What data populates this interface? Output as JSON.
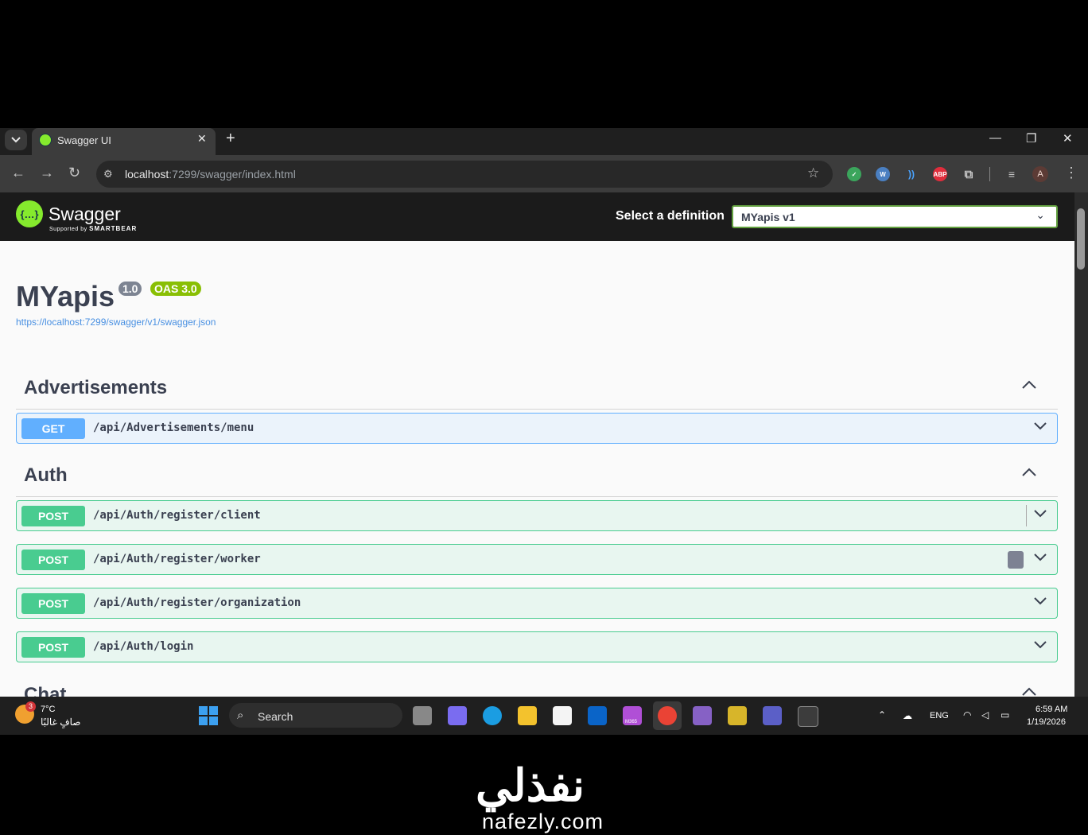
{
  "browser": {
    "tab_title": "Swagger UI",
    "url_host": "localhost",
    "url_rest": ":7299/swagger/index.html",
    "avatar_letter": "A",
    "ext_abp": "ABP"
  },
  "swagger": {
    "brand": "Swagger",
    "supported_by": "Supported by",
    "smartbear": "SMARTBEAR",
    "select_label": "Select a definition",
    "selected_definition": "MYapis v1",
    "title": "MYapis",
    "version_badge": "1.0",
    "oas_badge": "OAS 3.0",
    "spec_url": "https://localhost:7299/swagger/v1/swagger.json",
    "colors": {
      "get": "#61affe",
      "post": "#49cc90",
      "badge_version": "#7d8492",
      "badge_oas": "#89bf04",
      "brand": "#85ea2d"
    }
  },
  "tags": [
    {
      "name": "Advertisements",
      "operations": [
        {
          "method": "GET",
          "path": "/api/Advertisements/menu"
        }
      ]
    },
    {
      "name": "Auth",
      "operations": [
        {
          "method": "POST",
          "path": "/api/Auth/register/client"
        },
        {
          "method": "POST",
          "path": "/api/Auth/register/worker"
        },
        {
          "method": "POST",
          "path": "/api/Auth/register/organization"
        },
        {
          "method": "POST",
          "path": "/api/Auth/login"
        }
      ]
    },
    {
      "name": "Chat",
      "operations": []
    }
  ],
  "taskbar": {
    "weather_badge": "3",
    "temperature": "7°C",
    "condition": "صافٍ غالبًا",
    "search_placeholder": "Search",
    "language": "ENG",
    "time": "6:59 AM",
    "date": "1/19/2026",
    "m365_label": "M365"
  },
  "watermark": {
    "arabic": "نفذلي",
    "latin": "nafezly.com"
  }
}
